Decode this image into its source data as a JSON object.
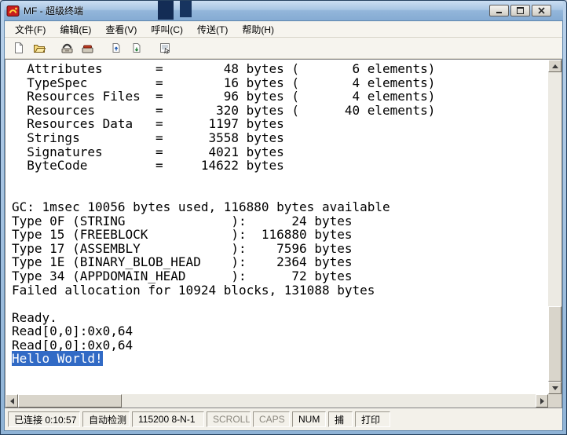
{
  "colors": {
    "selection_bg": "#316AC5",
    "selection_fg": "#FFFFFF",
    "titlebar_top": "#CBDEF2",
    "titlebar_bottom": "#85ABD3"
  },
  "window": {
    "title": "MF - 超级终端",
    "icon": "hyperterminal-icon",
    "control_icons": [
      "minimize-icon",
      "maximize-icon",
      "close-icon"
    ]
  },
  "menubar": {
    "items": [
      "文件(F)",
      "编辑(E)",
      "查看(V)",
      "呼叫(C)",
      "传送(T)",
      "帮助(H)"
    ]
  },
  "toolbar": {
    "icons": [
      "new-document-icon",
      "open-folder-icon",
      "call-icon",
      "hangup-icon",
      "send-icon",
      "receive-icon",
      "properties-icon"
    ]
  },
  "terminal": {
    "lines": [
      "  Attributes       =        48 bytes (       6 elements)",
      "  TypeSpec         =        16 bytes (       4 elements)",
      "  Resources Files  =        96 bytes (       4 elements)",
      "  Resources        =       320 bytes (      40 elements)",
      "  Resources Data   =      1197 bytes",
      "  Strings          =      3558 bytes",
      "  Signatures       =      4021 bytes",
      "  ByteCode         =     14622 bytes",
      "",
      "",
      "GC: 1msec 10056 bytes used, 116880 bytes available",
      "Type 0F (STRING              ):      24 bytes",
      "Type 15 (FREEBLOCK           ):  116880 bytes",
      "Type 17 (ASSEMBLY            ):    7596 bytes",
      "Type 1E (BINARY_BLOB_HEAD    ):    2364 bytes",
      "Type 34 (APPDOMAIN_HEAD      ):      72 bytes",
      "Failed allocation for 10924 blocks, 131088 bytes",
      "",
      "Ready.",
      "Read[0,0]:0x0,64",
      "Read[0,0]:0x0,64",
      ""
    ],
    "selected_text": "Hello World!"
  },
  "statusbar": {
    "connected": "已连接 0:10:57",
    "detect": "自动检测",
    "baud": "115200 8-N-1",
    "scroll": "SCROLL",
    "caps": "CAPS",
    "num": "NUM",
    "capture": "捕",
    "print": "打印"
  }
}
